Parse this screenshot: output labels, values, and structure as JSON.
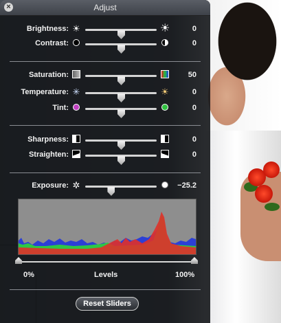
{
  "panel": {
    "title": "Adjust",
    "close_icon": "close-icon"
  },
  "sliders_group1": [
    {
      "label": "Brightness:",
      "value": "0",
      "icon_left": "sun-small-icon",
      "icon_right": "sun-large-icon",
      "level": 0.5
    },
    {
      "label": "Contrast:",
      "value": "0",
      "icon_left": "contrast-low-icon",
      "icon_right": "contrast-high-icon",
      "level": 0.5
    }
  ],
  "sliders_group2": [
    {
      "label": "Saturation:",
      "value": "50",
      "icon_left": "saturation-gray-icon",
      "icon_right": "saturation-color-icon",
      "level": 0.5
    },
    {
      "label": "Temperature:",
      "value": "0",
      "icon_left": "temperature-cool-icon",
      "icon_right": "temperature-warm-icon",
      "level": 0.5
    },
    {
      "label": "Tint:",
      "value": "0",
      "icon_left": "tint-magenta-icon",
      "icon_right": "tint-green-icon",
      "level": 0.5
    }
  ],
  "sliders_group3": [
    {
      "label": "Sharpness:",
      "value": "0",
      "icon_left": "sharpness-soft-icon",
      "icon_right": "sharpness-sharp-icon",
      "level": 0.5
    },
    {
      "label": "Straighten:",
      "value": "0",
      "icon_left": "straighten-left-icon",
      "icon_right": "straighten-right-icon",
      "level": 0.5
    }
  ],
  "exposure": {
    "label": "Exposure:",
    "value": "−25.2",
    "icon_left": "aperture-icon",
    "icon_right": "exposure-dot-icon",
    "level": 0.36
  },
  "levels": {
    "left_label": "0%",
    "center_label": "Levels",
    "right_label": "100%",
    "black_point": 0.0,
    "white_point": 1.0
  },
  "reset_button": "Reset Sliders",
  "colors": {
    "panel_bg": "#16181c",
    "histogram_bg": "#8e8e8e",
    "histogram_blue": "#2c3fd6",
    "histogram_green": "#2fd23a",
    "histogram_red": "#e0302a"
  }
}
